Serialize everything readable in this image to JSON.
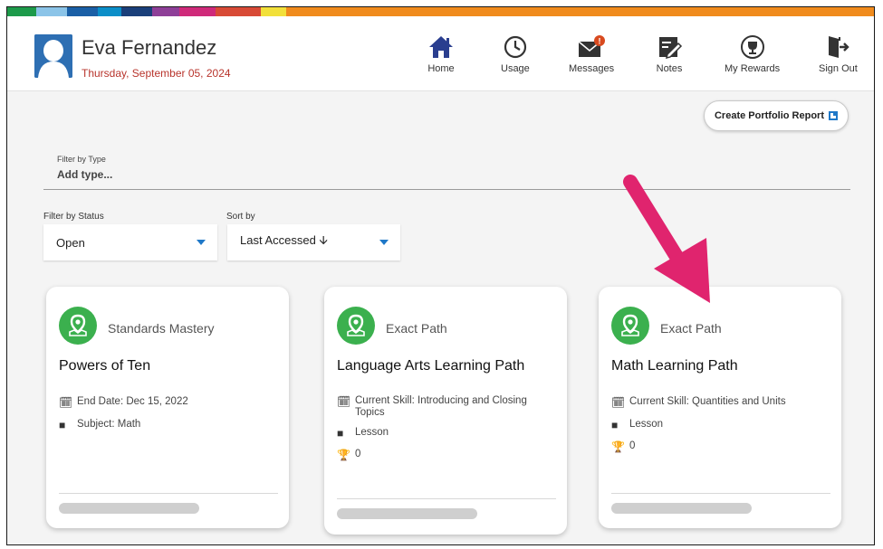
{
  "brand_colors": [
    "#1d9a4a",
    "#8bc4e8",
    "#1a5fa6",
    "#0b8ec8",
    "#8e3f98",
    "#cf2a7a",
    "#d84a36",
    "#f2e03a",
    "#f08b1d"
  ],
  "user": {
    "name": "Eva Fernandez",
    "date": "Thursday, September 05, 2024"
  },
  "nav": [
    {
      "label": "Home",
      "icon": "home-icon",
      "active": true
    },
    {
      "label": "Usage",
      "icon": "clock-icon"
    },
    {
      "label": "Messages",
      "icon": "envelope-icon",
      "badge": "!"
    },
    {
      "label": "Notes",
      "icon": "notes-icon"
    },
    {
      "label": "My Rewards",
      "icon": "trophy-icon"
    },
    {
      "label": "Sign Out",
      "icon": "sign-out-icon"
    }
  ],
  "portfolio_button": "Create Portfolio Report",
  "filter_type": {
    "label": "Filter by Type",
    "value": "Add type..."
  },
  "filter_status": {
    "label": "Filter by Status",
    "value": "Open"
  },
  "sort_by": {
    "label": "Sort by",
    "value": "Last Accessed 🡫"
  },
  "cards": [
    {
      "type": "Standards Mastery",
      "title": "Powers of Ten",
      "rows": [
        {
          "icon": "calendar-icon",
          "text": "End Date: Dec 15, 2022"
        },
        {
          "icon": "book-icon",
          "text": "Subject: Math"
        }
      ]
    },
    {
      "type": "Exact Path",
      "title": "Language Arts Learning Path",
      "rows": [
        {
          "icon": "calendar-icon",
          "text": "Current Skill: Introducing and Closing Topics"
        },
        {
          "icon": "book-icon",
          "text": "Lesson"
        },
        {
          "icon": "trophy-icon",
          "text": "0"
        }
      ]
    },
    {
      "type": "Exact Path",
      "title": "Math Learning Path",
      "rows": [
        {
          "icon": "calendar-icon",
          "text": "Current Skill: Quantities and Units"
        },
        {
          "icon": "book-icon",
          "text": "Lesson"
        },
        {
          "icon": "trophy-icon",
          "text": "0"
        }
      ]
    }
  ],
  "annotation_arrow_color": "#e0246e"
}
